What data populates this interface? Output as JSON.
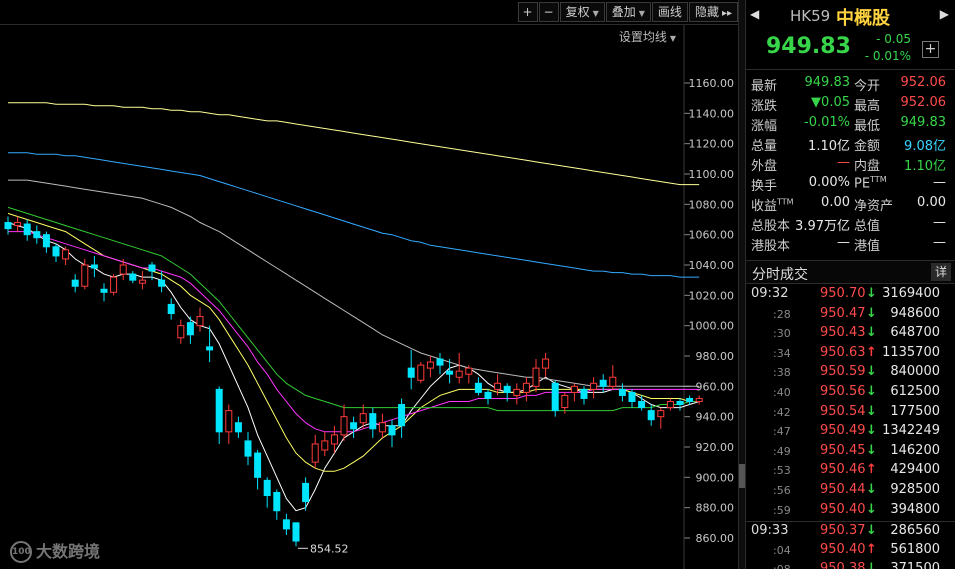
{
  "toolbar": {
    "zoom_in": "+",
    "zoom_out": "−",
    "adjust": "复权",
    "overlay": "叠加",
    "draw": "画线",
    "hide": "隐藏",
    "expand": "▸▸",
    "ma_settings": "设置均线"
  },
  "price_axis": {
    "ticks": [
      "1160.00",
      "1140.00",
      "1120.00",
      "1100.00",
      "1080.00",
      "1060.00",
      "1040.00",
      "1020.00",
      "1000.00",
      "980.00",
      "960.00",
      "940.00",
      "920.00",
      "900.00",
      "880.00",
      "860.00"
    ]
  },
  "annotations": {
    "low_label": "854.52"
  },
  "watermark": {
    "logo": "100",
    "text": "大数跨境"
  },
  "stock": {
    "code": "HK59",
    "name": "中概股",
    "last_price": "949.83",
    "change_abs": "- 0.05",
    "change_pct": "- 0.01%"
  },
  "quote": {
    "rows": [
      {
        "l1": "最新",
        "v1": "949.83",
        "c1": "green",
        "l2": "今开",
        "v2": "952.06",
        "c2": "red"
      },
      {
        "l1": "涨跌",
        "v1": "▼0.05",
        "c1": "green",
        "l2": "最高",
        "v2": "952.06",
        "c2": "red"
      },
      {
        "l1": "涨幅",
        "v1": "-0.01%",
        "c1": "green",
        "l2": "最低",
        "v2": "949.83",
        "c2": "green"
      },
      {
        "l1": "总量",
        "v1": "1.10亿",
        "c1": "white",
        "l2": "金额",
        "v2": "9.08亿",
        "c2": "cyan"
      },
      {
        "l1": "外盘",
        "v1": "—",
        "c1": "red",
        "l2": "内盘",
        "v2": "1.10亿",
        "c2": "green"
      },
      {
        "l1": "换手",
        "v1": "0.00%",
        "c1": "white",
        "l2": "PE",
        "v2": "—",
        "c2": "white"
      },
      {
        "l1": "收益",
        "v1": "0.00",
        "c1": "white",
        "l2": "净资产",
        "v2": "0.00",
        "c2": "white"
      },
      {
        "l1": "总股本",
        "v1": "3.97万亿",
        "c1": "white",
        "l2": "总值",
        "v2": "—",
        "c2": "white"
      },
      {
        "l1": "港股本",
        "v1": "—",
        "c1": "white",
        "l2": "港值",
        "v2": "—",
        "c2": "white"
      }
    ],
    "ttm": "TTM"
  },
  "ticks_panel": {
    "title": "分时成交",
    "detail": "详",
    "rows": [
      {
        "time": "09:32",
        "minor": false,
        "price": "950.70",
        "dir": "down",
        "vol": "3169400"
      },
      {
        "time": ":28",
        "minor": true,
        "price": "950.47",
        "dir": "down",
        "vol": "948600"
      },
      {
        "time": ":30",
        "minor": true,
        "price": "950.43",
        "dir": "down",
        "vol": "648700"
      },
      {
        "time": ":34",
        "minor": true,
        "price": "950.63",
        "dir": "up",
        "vol": "1135700"
      },
      {
        "time": ":38",
        "minor": true,
        "price": "950.59",
        "dir": "down",
        "vol": "840000"
      },
      {
        "time": ":40",
        "minor": true,
        "price": "950.56",
        "dir": "down",
        "vol": "612500"
      },
      {
        "time": ":42",
        "minor": true,
        "price": "950.54",
        "dir": "down",
        "vol": "177500"
      },
      {
        "time": ":47",
        "minor": true,
        "price": "950.49",
        "dir": "down",
        "vol": "1342249"
      },
      {
        "time": ":49",
        "minor": true,
        "price": "950.45",
        "dir": "down",
        "vol": "146200"
      },
      {
        "time": ":53",
        "minor": true,
        "price": "950.46",
        "dir": "up",
        "vol": "429400"
      },
      {
        "time": ":56",
        "minor": true,
        "price": "950.44",
        "dir": "down",
        "vol": "928500"
      },
      {
        "time": ":59",
        "minor": true,
        "price": "950.40",
        "dir": "down",
        "vol": "394800"
      },
      {
        "time": "09:33",
        "minor": false,
        "price": "950.37",
        "dir": "down",
        "vol": "286560",
        "sep": true
      },
      {
        "time": ":04",
        "minor": true,
        "price": "950.40",
        "dir": "up",
        "vol": "561800"
      },
      {
        "time": ":08",
        "minor": true,
        "price": "950.38",
        "dir": "down",
        "vol": "371500"
      }
    ]
  },
  "colors": {
    "up": "#ff3b3b",
    "down": "#00e5ff",
    "ma5": "#ffffff",
    "ma10": "#ffff66",
    "ma20": "#ff33ff",
    "ma30": "#33cc33",
    "ma60": "#bbbbbb",
    "ma120": "#33aaff",
    "ma250": "#ffff99"
  },
  "chart_data": {
    "type": "candlestick",
    "ylim": [
      850,
      1170
    ],
    "candles": [
      [
        1068,
        1064,
        1072,
        1060
      ],
      [
        1066,
        1068,
        1072,
        1062
      ],
      [
        1067,
        1060,
        1070,
        1056
      ],
      [
        1062,
        1058,
        1066,
        1054
      ],
      [
        1060,
        1052,
        1062,
        1048
      ],
      [
        1052,
        1046,
        1054,
        1042
      ],
      [
        1044,
        1050,
        1052,
        1040
      ],
      [
        1030,
        1026,
        1034,
        1022
      ],
      [
        1026,
        1040,
        1044,
        1024
      ],
      [
        1040,
        1038,
        1046,
        1032
      ],
      [
        1024,
        1022,
        1028,
        1016
      ],
      [
        1022,
        1032,
        1034,
        1020
      ],
      [
        1034,
        1040,
        1044,
        1030
      ],
      [
        1034,
        1030,
        1036,
        1028
      ],
      [
        1028,
        1030,
        1036,
        1024
      ],
      [
        1040,
        1036,
        1042,
        1030
      ],
      [
        1030,
        1026,
        1036,
        1022
      ],
      [
        1014,
        1008,
        1018,
        1004
      ],
      [
        992,
        1000,
        1004,
        988
      ],
      [
        1002,
        994,
        1006,
        988
      ],
      [
        1000,
        1006,
        1012,
        996
      ],
      [
        986,
        984,
        1000,
        976
      ],
      [
        958,
        930,
        960,
        922
      ],
      [
        930,
        944,
        948,
        922
      ],
      [
        936,
        930,
        940,
        926
      ],
      [
        924,
        914,
        930,
        908
      ],
      [
        916,
        900,
        918,
        892
      ],
      [
        898,
        888,
        900,
        880
      ],
      [
        890,
        878,
        892,
        872
      ],
      [
        872,
        866,
        876,
        862
      ],
      [
        870,
        858,
        870,
        854.52
      ],
      [
        896,
        884,
        900,
        878
      ],
      [
        910,
        922,
        928,
        906
      ],
      [
        918,
        924,
        930,
        914
      ],
      [
        922,
        928,
        934,
        916
      ],
      [
        928,
        940,
        948,
        924
      ],
      [
        936,
        932,
        940,
        926
      ],
      [
        936,
        942,
        948,
        932
      ],
      [
        942,
        932,
        946,
        926
      ],
      [
        930,
        936,
        942,
        926
      ],
      [
        934,
        928,
        938,
        920
      ],
      [
        948,
        934,
        952,
        926
      ],
      [
        972,
        966,
        984,
        958
      ],
      [
        964,
        974,
        976,
        962
      ],
      [
        972,
        976,
        980,
        966
      ],
      [
        978,
        974,
        982,
        968
      ],
      [
        970,
        968,
        978,
        962
      ],
      [
        966,
        970,
        982,
        962
      ],
      [
        968,
        972,
        974,
        962
      ],
      [
        962,
        956,
        966,
        954
      ],
      [
        956,
        952,
        958,
        948
      ],
      [
        958,
        962,
        968,
        954
      ],
      [
        960,
        956,
        962,
        950
      ],
      [
        954,
        958,
        962,
        948
      ],
      [
        956,
        962,
        966,
        950
      ],
      [
        960,
        972,
        978,
        956
      ],
      [
        972,
        978,
        982,
        966
      ],
      [
        962,
        944,
        964,
        940
      ],
      [
        946,
        954,
        956,
        942
      ],
      [
        956,
        960,
        962,
        950
      ],
      [
        958,
        952,
        960,
        948
      ],
      [
        958,
        962,
        966,
        952
      ],
      [
        964,
        960,
        968,
        956
      ],
      [
        960,
        966,
        974,
        958
      ],
      [
        958,
        954,
        962,
        950
      ],
      [
        956,
        950,
        958,
        946
      ],
      [
        950,
        946,
        954,
        944
      ],
      [
        944,
        938,
        948,
        934
      ],
      [
        940,
        944,
        946,
        932
      ],
      [
        946,
        950,
        952,
        944
      ],
      [
        950,
        948,
        952,
        944
      ],
      [
        952,
        950,
        954,
        948
      ],
      [
        950,
        952,
        954,
        948
      ]
    ],
    "ma_lines": [
      {
        "name": "MA5",
        "values": [
          1068,
          1066,
          1064,
          1060,
          1056,
          1054,
          1050,
          1044,
          1040,
          1038,
          1034,
          1032,
          1034,
          1034,
          1032,
          1032,
          1030,
          1022,
          1012,
          1004,
          1000,
          998,
          988,
          974,
          960,
          946,
          928,
          914,
          900,
          886,
          878,
          880,
          892,
          906,
          916,
          926,
          930,
          934,
          936,
          934,
          934,
          934,
          944,
          952,
          960,
          966,
          972,
          974,
          972,
          968,
          962,
          958,
          956,
          956,
          958,
          962,
          966,
          962,
          960,
          958,
          956,
          956,
          956,
          958,
          958,
          956,
          952,
          948,
          946,
          946,
          946,
          948,
          950
        ]
      },
      {
        "name": "MA10",
        "values": [
          1074,
          1072,
          1070,
          1068,
          1066,
          1064,
          1062,
          1058,
          1054,
          1050,
          1046,
          1044,
          1042,
          1040,
          1038,
          1036,
          1034,
          1030,
          1026,
          1020,
          1016,
          1012,
          1004,
          994,
          984,
          974,
          962,
          950,
          938,
          926,
          916,
          910,
          906,
          904,
          904,
          906,
          910,
          914,
          920,
          926,
          930,
          934,
          940,
          946,
          950,
          954,
          956,
          958,
          958,
          958,
          958,
          956,
          956,
          956,
          956,
          958,
          958,
          958,
          958,
          958,
          958,
          958,
          958,
          958,
          958,
          956,
          954,
          952,
          952,
          952,
          952,
          950,
          950
        ]
      },
      {
        "name": "MA20",
        "values": [
          1062,
          1062,
          1062,
          1060,
          1058,
          1056,
          1054,
          1052,
          1050,
          1048,
          1046,
          1044,
          1042,
          1040,
          1038,
          1038,
          1036,
          1034,
          1032,
          1028,
          1022,
          1016,
          1010,
          1002,
          994,
          986,
          976,
          968,
          958,
          950,
          942,
          936,
          932,
          930,
          930,
          930,
          930,
          932,
          934,
          936,
          938,
          940,
          942,
          944,
          946,
          948,
          950,
          950,
          950,
          952,
          952,
          952,
          952,
          952,
          954,
          954,
          956,
          956,
          956,
          956,
          956,
          958,
          958,
          958,
          958,
          958,
          958,
          958,
          958,
          958,
          958,
          958,
          958
        ]
      },
      {
        "name": "MA30",
        "values": [
          1078,
          1076,
          1074,
          1072,
          1070,
          1068,
          1066,
          1064,
          1062,
          1060,
          1058,
          1056,
          1054,
          1052,
          1050,
          1048,
          1046,
          1042,
          1038,
          1034,
          1028,
          1022,
          1016,
          1008,
          1000,
          992,
          984,
          976,
          968,
          962,
          958,
          954,
          952,
          950,
          948,
          946,
          946,
          946,
          946,
          946,
          946,
          946,
          946,
          946,
          946,
          946,
          946,
          946,
          946,
          946,
          946,
          944,
          944,
          944,
          944,
          944,
          944,
          944,
          944,
          944,
          944,
          944,
          944,
          944,
          946,
          946,
          946,
          946,
          948,
          948,
          948,
          950,
          950
        ]
      },
      {
        "name": "MA60",
        "values": [
          1096,
          1096,
          1096,
          1095,
          1094,
          1093,
          1092,
          1091,
          1090,
          1089,
          1088,
          1087,
          1086,
          1085,
          1084,
          1082,
          1080,
          1078,
          1075,
          1072,
          1068,
          1065,
          1062,
          1058,
          1054,
          1050,
          1046,
          1042,
          1038,
          1034,
          1030,
          1026,
          1022,
          1018,
          1014,
          1010,
          1006,
          1002,
          998,
          994,
          991,
          988,
          985,
          982,
          980,
          978,
          976,
          974,
          972,
          971,
          970,
          969,
          968,
          967,
          966,
          966,
          965,
          964,
          963,
          962,
          961,
          960,
          960,
          960,
          960,
          960,
          960,
          960,
          960,
          960,
          960,
          960,
          960
        ]
      },
      {
        "name": "MA120",
        "values": [
          1114,
          1114,
          1114,
          1113,
          1113,
          1113,
          1112,
          1112,
          1111,
          1110,
          1109,
          1108,
          1107,
          1106,
          1105,
          1104,
          1103,
          1102,
          1101,
          1100,
          1099,
          1097,
          1095,
          1093,
          1091,
          1089,
          1087,
          1085,
          1083,
          1081,
          1079,
          1077,
          1075,
          1073,
          1071,
          1069,
          1067,
          1065,
          1063,
          1061,
          1060,
          1058,
          1056,
          1055,
          1053,
          1052,
          1051,
          1050,
          1049,
          1048,
          1047,
          1046,
          1045,
          1044,
          1043,
          1042,
          1041,
          1040,
          1039,
          1038,
          1037,
          1036,
          1036,
          1035,
          1035,
          1034,
          1034,
          1033,
          1033,
          1033,
          1032,
          1032,
          1032
        ]
      },
      {
        "name": "MA250",
        "values": [
          1147,
          1147,
          1147,
          1147,
          1147,
          1146,
          1146,
          1146,
          1146,
          1145,
          1145,
          1145,
          1144,
          1144,
          1144,
          1143,
          1143,
          1142,
          1142,
          1141,
          1141,
          1140,
          1139,
          1139,
          1138,
          1137,
          1136,
          1135,
          1135,
          1134,
          1133,
          1132,
          1131,
          1130,
          1129,
          1128,
          1127,
          1126,
          1125,
          1124,
          1123,
          1122,
          1121,
          1120,
          1119,
          1118,
          1117,
          1116,
          1115,
          1114,
          1113,
          1112,
          1111,
          1110,
          1109,
          1108,
          1107,
          1106,
          1105,
          1104,
          1103,
          1102,
          1101,
          1100,
          1099,
          1098,
          1097,
          1096,
          1095,
          1094,
          1093,
          1093,
          1093
        ]
      }
    ]
  }
}
